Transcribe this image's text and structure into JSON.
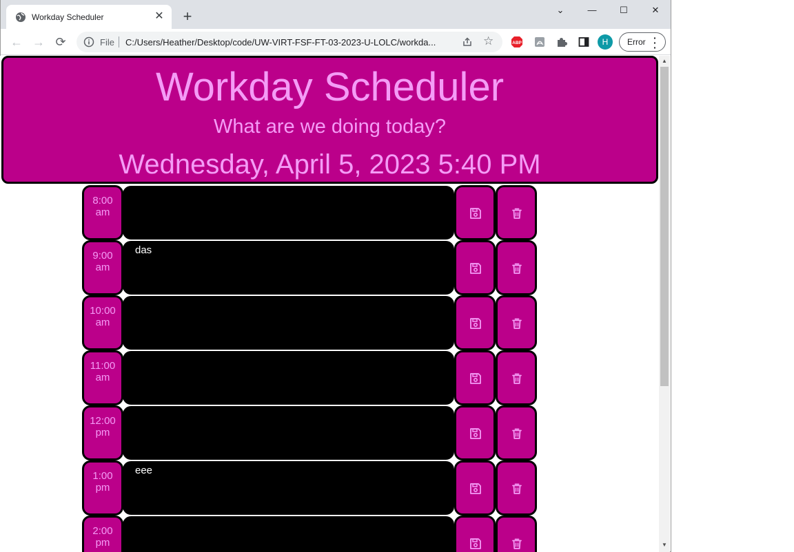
{
  "browser": {
    "tab_title": "Workday Scheduler",
    "tab_close": "✕",
    "new_tab": "+",
    "scheme": "File",
    "url": "C:/Users/Heather/Desktop/code/UW-VIRT-FSF-FT-03-2023-U-LOLC/workda...",
    "profile_initial": "H",
    "error_label": "Error",
    "window_controls": [
      "⌄",
      "—",
      "☐",
      "✕"
    ],
    "ext_abp": "ABP"
  },
  "header": {
    "title": "Workday Scheduler",
    "lead": "What are we doing today?",
    "current_day": "Wednesday, April 5, 2023 5:40 PM"
  },
  "colors": {
    "accent": "#bb008a",
    "accent_text": "#f49cf6",
    "past_block": "#000000"
  },
  "rows": [
    {
      "hour": "8:00",
      "ampm": "am",
      "text": ""
    },
    {
      "hour": "9:00",
      "ampm": "am",
      "text": "das"
    },
    {
      "hour": "10:00",
      "ampm": "am",
      "text": ""
    },
    {
      "hour": "11:00",
      "ampm": "am",
      "text": ""
    },
    {
      "hour": "12:00",
      "ampm": "pm",
      "text": ""
    },
    {
      "hour": "1:00",
      "ampm": "pm",
      "text": "eee"
    },
    {
      "hour": "2:00",
      "ampm": "pm",
      "text": ""
    }
  ],
  "icons": {
    "save": "floppy-disk-icon",
    "delete": "trash-icon"
  }
}
